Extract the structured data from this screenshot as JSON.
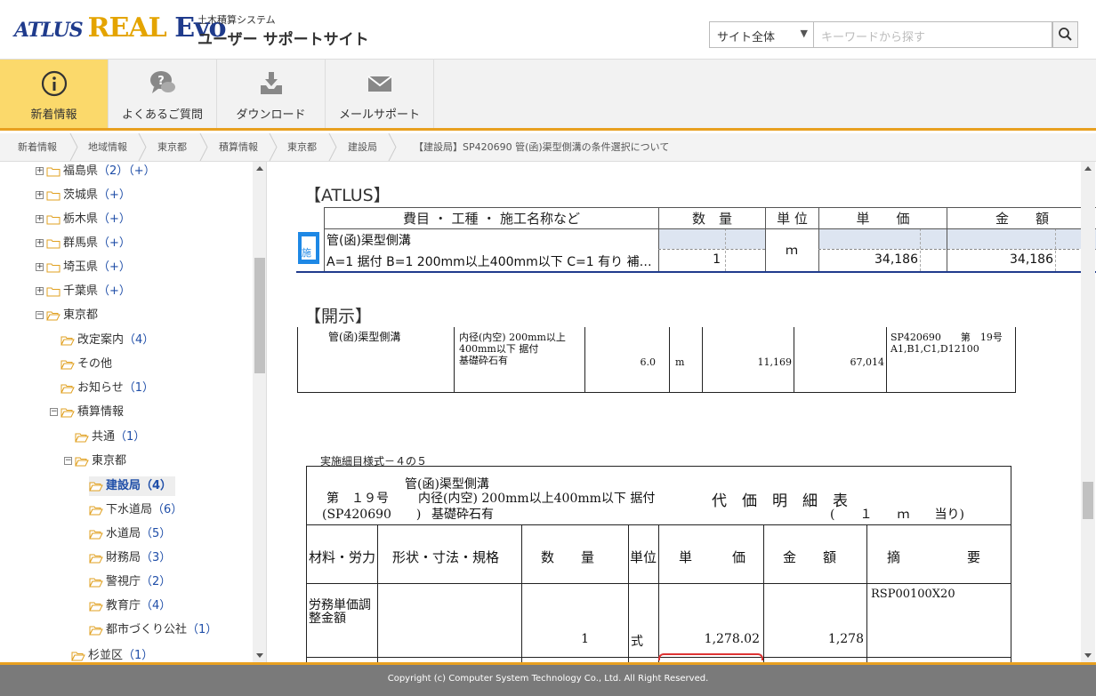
{
  "header": {
    "logo_atlus": "ATLUS",
    "logo_real": "REAL",
    "logo_evo": "Evo",
    "sub_title": "土木積算システム",
    "site_title": "ユーザー サポートサイト"
  },
  "search": {
    "scope": "サイト全体",
    "placeholder": "キーワードから探す"
  },
  "nav": {
    "items": [
      {
        "label": "新着情報",
        "icon": "info-icon",
        "active": true
      },
      {
        "label": "よくあるご質問",
        "icon": "faq-icon",
        "active": false
      },
      {
        "label": "ダウンロード",
        "icon": "download-icon",
        "active": false
      },
      {
        "label": "メールサポート",
        "icon": "mail-icon",
        "active": false
      }
    ]
  },
  "breadcrumb": [
    "新着情報",
    "地域情報",
    "東京都",
    "積算情報",
    "東京都",
    "建設局",
    "【建設局】SP420690 管(函)渠型側溝の条件選択について"
  ],
  "tree": [
    {
      "label": "福島県",
      "count": "（2）（+）"
    },
    {
      "label": "茨城県",
      "count": "（+）"
    },
    {
      "label": "栃木県",
      "count": "（+）"
    },
    {
      "label": "群馬県",
      "count": "（+）"
    },
    {
      "label": "埼玉県",
      "count": "（+）"
    },
    {
      "label": "千葉県",
      "count": "（+）"
    },
    {
      "label": "東京都",
      "count": ""
    },
    {
      "label": "改定案内",
      "count": "（4）"
    },
    {
      "label": "その他",
      "count": ""
    },
    {
      "label": "お知らせ",
      "count": "（1）"
    },
    {
      "label": "積算情報",
      "count": ""
    },
    {
      "label": "共通",
      "count": "（1）"
    },
    {
      "label": "東京都",
      "count": ""
    },
    {
      "label": "建設局",
      "count": "（4）"
    },
    {
      "label": "下水道局",
      "count": "（6）"
    },
    {
      "label": "水道局",
      "count": "（5）"
    },
    {
      "label": "財務局",
      "count": "（3）"
    },
    {
      "label": "警視庁",
      "count": "（2）"
    },
    {
      "label": "教育庁",
      "count": "（4）"
    },
    {
      "label": "都市づくり公社",
      "count": "（1）"
    },
    {
      "label": "杉並区",
      "count": "（1）"
    }
  ],
  "atlus_section": {
    "title": "【ATLUS】",
    "headers": [
      "費目 ・ 工種 ・ 施工名称など",
      "数　量",
      "単 位",
      "単　　価",
      "金　　額"
    ],
    "icon_char": "施",
    "row_name": "管(函)渠型側溝",
    "row_detail": "A=1 据付 B=1 200mm以上400mm以下 C=1 有り 補…",
    "quantity": "1",
    "unit": "ｍ",
    "unit_price": "34,186",
    "amount": "34,186"
  },
  "kaiji_section": {
    "title": "【開示】",
    "name": "管(函)渠型側溝",
    "spec_line1": "内径(内空) 200mm以上",
    "spec_line2": "400mm以下 据付",
    "spec_line3": "基礎砕石有",
    "quantity": "6.0",
    "unit": "m",
    "unit_price": "11,169",
    "amount": "67,014",
    "remark_line1": "SP420690　　第　19号",
    "remark_line2": "A1,B1,C1,D12100"
  },
  "detail_section": {
    "caption": "実施細目様式－４の５",
    "title_name": "管(函)渠型側溝",
    "title_no": "第　１９号",
    "title_spec": "内径(内空) 200mm以上400mm以下 据付",
    "title_code": "(SP420690　　)",
    "title_base": "基礎砕石有",
    "title_label": "代　価　明　細　表",
    "title_per": "(　　１　　ｍ　　当り)",
    "headers": [
      "材料・労力",
      "形状・寸法・規格",
      "数　　量",
      "単位",
      "単　　　価",
      "金　　額",
      "摘　　　　　要"
    ],
    "row_name_1": "労務単価調",
    "row_name_2": "整金額",
    "row_quantity": "1",
    "row_unit": "式",
    "row_unit_price": "1,278.02",
    "row_amount": "1,278",
    "row_remark": "RSP00100X20"
  },
  "footer": {
    "copyright": "Copyright (c) Computer System Technology Co., Ltd. All Right Reserved."
  }
}
